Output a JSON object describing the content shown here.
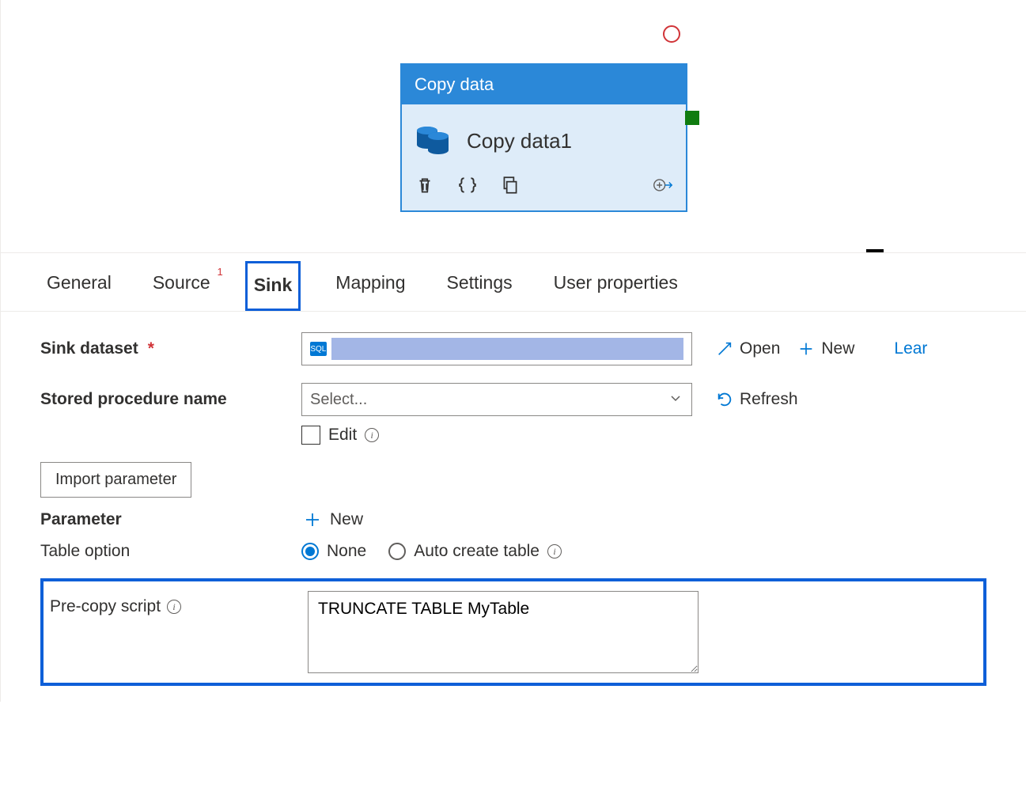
{
  "node": {
    "type_label": "Copy data",
    "name": "Copy data1"
  },
  "tabs": {
    "general": "General",
    "source": "Source",
    "source_badge": "1",
    "sink": "Sink",
    "mapping": "Mapping",
    "settings": "Settings",
    "user_properties": "User properties"
  },
  "sink": {
    "dataset_label": "Sink dataset",
    "stored_proc_label": "Stored procedure name",
    "stored_proc_placeholder": "Select...",
    "edit_label": "Edit",
    "import_param_label": "Import parameter",
    "parameter_label": "Parameter",
    "table_option_label": "Table option",
    "table_option_none": "None",
    "table_option_auto": "Auto create table",
    "precopy_label": "Pre-copy script",
    "precopy_value": "TRUNCATE TABLE MyTable"
  },
  "actions": {
    "open": "Open",
    "new": "New",
    "learn": "Lear",
    "refresh": "Refresh"
  }
}
